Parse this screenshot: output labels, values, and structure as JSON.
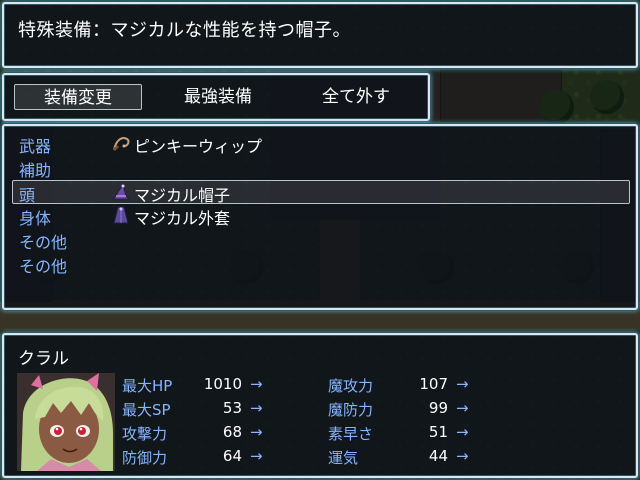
{
  "help": {
    "text": "特殊装備：マジカルな性能を持つ帽子。"
  },
  "commands": [
    {
      "label": "装備変更",
      "selected": true
    },
    {
      "label": "最強装備",
      "selected": false
    },
    {
      "label": "全て外す",
      "selected": false
    }
  ],
  "slots": [
    {
      "type": "武器",
      "item": "ピンキーウィップ",
      "icon": "whip-icon",
      "selected": false
    },
    {
      "type": "補助",
      "item": "",
      "icon": "",
      "selected": false
    },
    {
      "type": "頭",
      "item": "マジカル帽子",
      "icon": "witch-hat-icon",
      "selected": true
    },
    {
      "type": "身体",
      "item": "マジカル外套",
      "icon": "cloak-icon",
      "selected": false
    },
    {
      "type": "その他",
      "item": "",
      "icon": "",
      "selected": false
    },
    {
      "type": "その他",
      "item": "",
      "icon": "",
      "selected": false
    }
  ],
  "actor": {
    "name": "クラル",
    "portrait": "green-haired-girl-portrait"
  },
  "stats_left": [
    {
      "label": "最大HP",
      "value": "1010",
      "arrow": "→"
    },
    {
      "label": "最大SP",
      "value": "53",
      "arrow": "→"
    },
    {
      "label": "攻撃力",
      "value": "68",
      "arrow": "→"
    },
    {
      "label": "防御力",
      "value": "64",
      "arrow": "→"
    }
  ],
  "stats_right": [
    {
      "label": "魔攻力",
      "value": "107",
      "arrow": "→"
    },
    {
      "label": "魔防力",
      "value": "99",
      "arrow": "→"
    },
    {
      "label": "素早さ",
      "value": "51",
      "arrow": "→"
    },
    {
      "label": "運気",
      "value": "44",
      "arrow": "→"
    }
  ],
  "colors": {
    "system_blue": "#86b4ff",
    "window_border": "#d8e8f0",
    "window_glow": "#5ad2f0"
  }
}
